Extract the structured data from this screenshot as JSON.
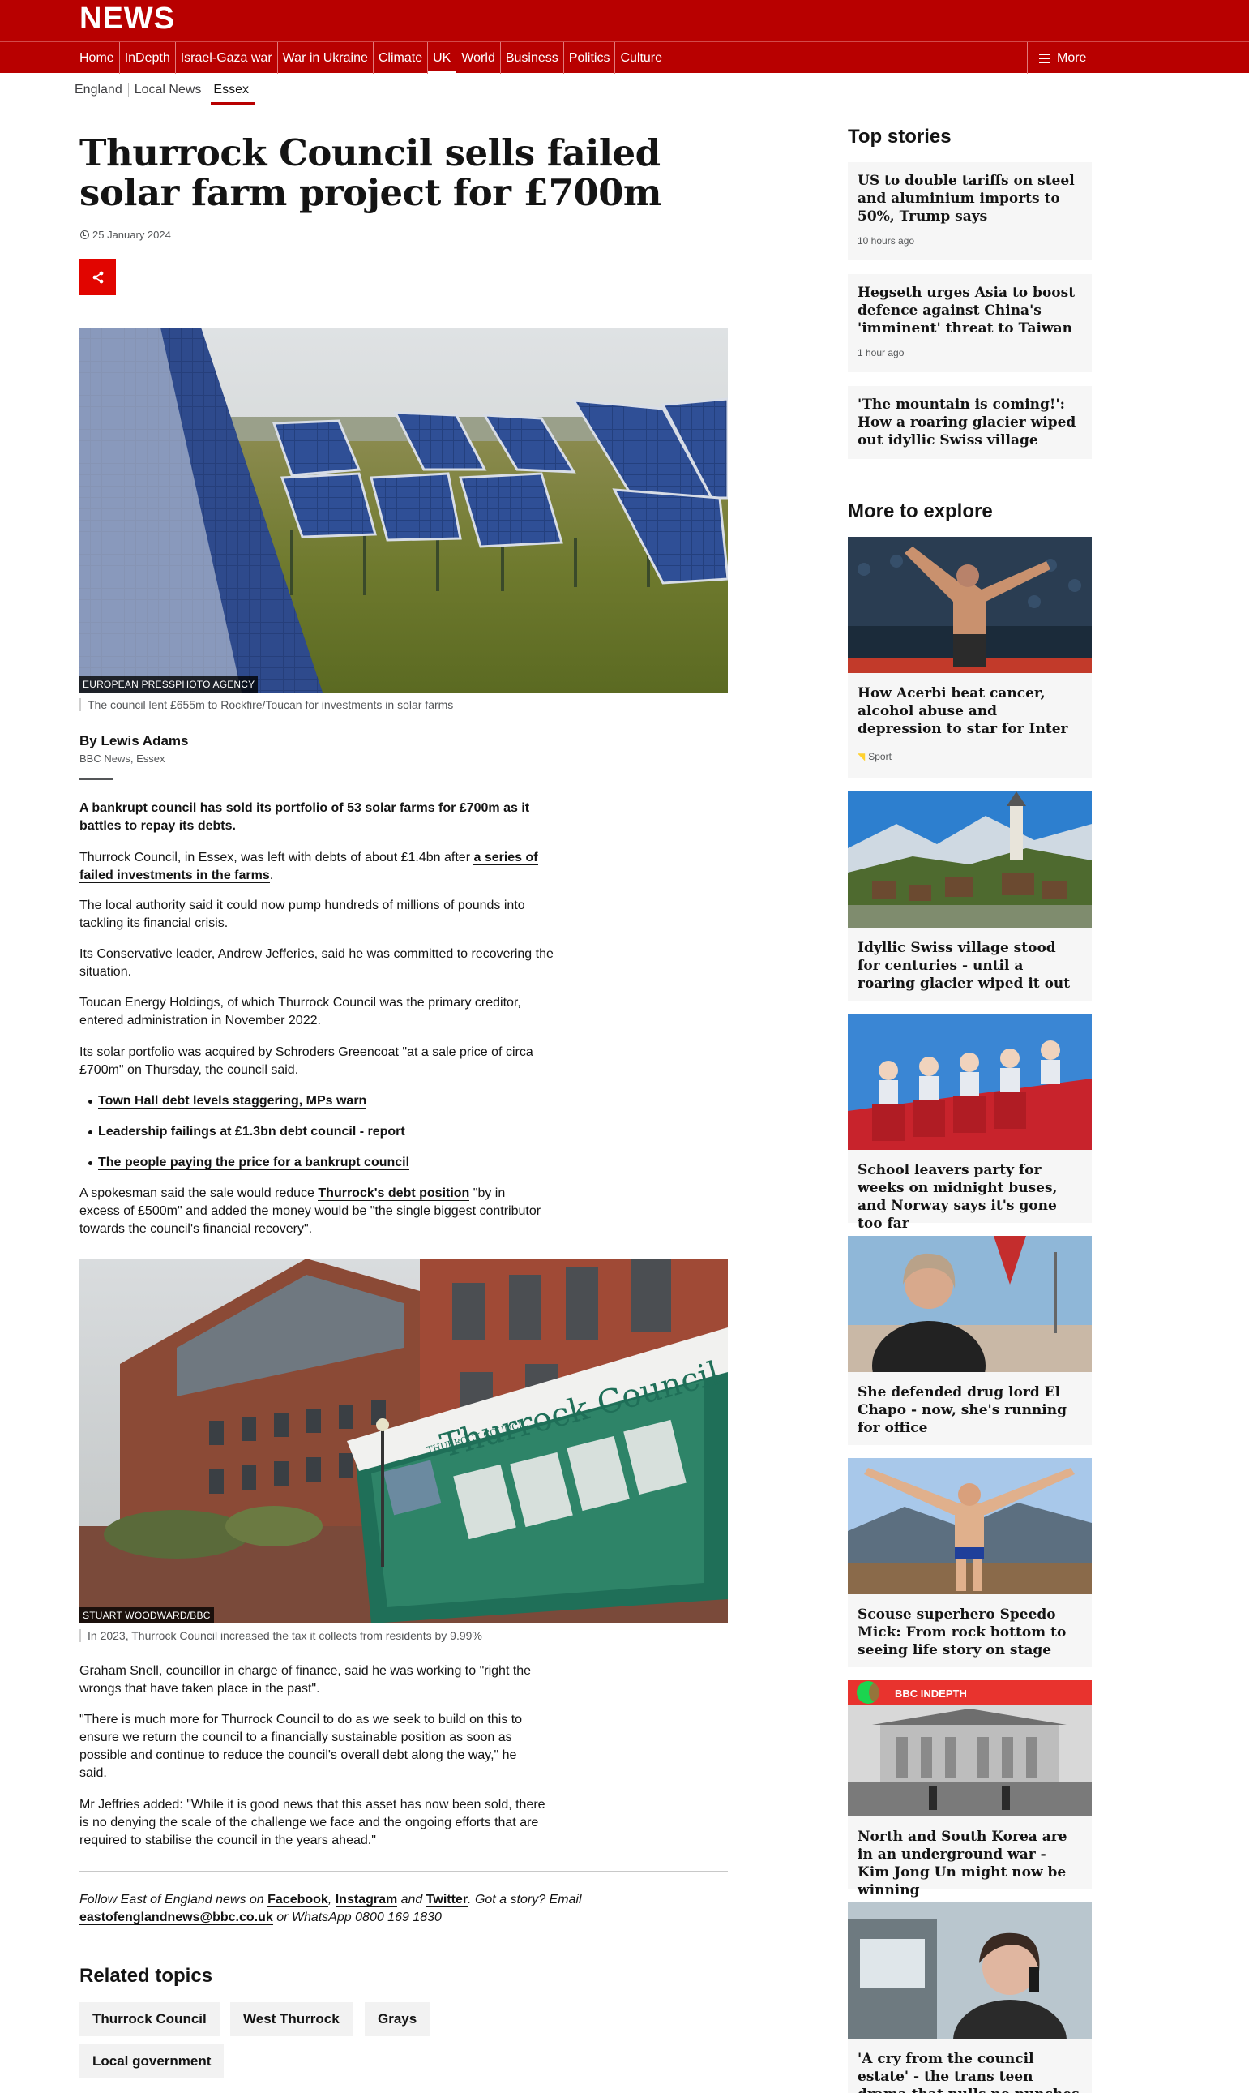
{
  "header": {
    "logo": "NEWS",
    "nav": [
      "Home",
      "InDepth",
      "Israel-Gaza war",
      "War in Ukraine",
      "Climate",
      "UK",
      "World",
      "Business",
      "Politics",
      "Culture"
    ],
    "active_nav": "UK",
    "more_label": "More"
  },
  "subnav": [
    "England",
    "Local News",
    "Essex"
  ],
  "article": {
    "headline": "Thurrock Council sells failed solar farm project for £700m",
    "date": "25 January 2024",
    "image1": {
      "credit": "EUROPEAN PRESSPHOTO AGENCY",
      "caption": "The council lent £655m to Rockfire/Toucan for investments in solar farms"
    },
    "author": "By Lewis Adams",
    "author_role": "BBC News, Essex",
    "lead": "A bankrupt council has sold its portfolio of 53 solar farms for £700m as it battles to repay its debts.",
    "p1_text": "Thurrock Council, in Essex, was left with debts of about £1.4bn after ",
    "p1_link": "a series of failed investments in the farms",
    "p1_end": ".",
    "p2": "The local authority said it could now pump hundreds of millions of pounds into tackling its financial crisis.",
    "p3": "Its Conservative leader, Andrew Jefferies, said he was committed to recovering the situation.",
    "p4": "Toucan Energy Holdings, of which Thurrock Council was the primary creditor, entered administration in November 2022.",
    "p5": "Its solar portfolio was acquired by Schroders Greencoat \"at a sale price of circa £700m\" on Thursday, the council said.",
    "bullets": [
      "Town Hall debt levels staggering, MPs warn",
      "Leadership failings at £1.3bn debt council - report",
      "The people paying the price for a bankrupt council"
    ],
    "p6_a": "A spokesman said the sale would reduce ",
    "p6_link": "Thurrock's debt position",
    "p6_b": " \"by in excess of £500m\" and added the money would be \"the single biggest contributor towards the council's financial recovery\".",
    "image2": {
      "credit": "STUART WOODWARD/BBC",
      "caption": "In 2023, Thurrock Council increased the tax it collects from residents by 9.99%",
      "sign_text": "Thurrock Council",
      "sign_small": "THURROCK COUNCIL"
    },
    "p7": "Graham Snell, councillor in charge of finance, said he was working to \"right the wrongs that have taken place in the past\".",
    "p8": "\"There is much more for Thurrock Council to do as we seek to build on this to ensure we return the council to a financially sustainable position as soon as possible and continue to reduce the council's overall debt along the way,\" he said.",
    "p9": "Mr Jeffries added: \"While it is good news that this asset has now been sold, there is no denying the scale of the challenge we face and the ongoing efforts that are required to stabilise the council in the years ahead.\"",
    "follow": {
      "t1": "Follow East of England news on ",
      "facebook": "Facebook",
      "comma": ", ",
      "instagram": "Instagram",
      "and": " and ",
      "twitter": "Twitter",
      "t2": ". Got a story? Email ",
      "email": "eastofenglandnews@bbc.co.uk",
      "t3": " or WhatsApp 0800 169 1830"
    }
  },
  "related": {
    "title": "Related topics",
    "topics": [
      "Thurrock Council",
      "West Thurrock",
      "Grays",
      "Local government"
    ]
  },
  "sidebar": {
    "top_title": "Top stories",
    "top_stories": [
      {
        "title": "US to double tariffs on steel and aluminium imports to 50%, Trump says",
        "time": "10 hours ago"
      },
      {
        "title": "Hegseth urges Asia to boost defence against China's 'imminent' threat to Taiwan",
        "time": "1 hour ago"
      },
      {
        "title": "'The mountain is coming!': How a roaring glacier wiped out idyllic Swiss village",
        "time": ""
      }
    ],
    "explore_title": "More to explore",
    "explore": [
      {
        "title": "How Acerbi beat cancer, alcohol abuse and depression to star for Inter",
        "tag": "Sport"
      },
      {
        "title": "Idyllic Swiss village stood for centuries - until a roaring glacier wiped it out"
      },
      {
        "title": "School leavers party for weeks on midnight buses, and Norway says it's gone too far"
      },
      {
        "title": "She defended drug lord El Chapo - now, she's running for office"
      },
      {
        "title": "Scouse superhero Speedo Mick: From rock bottom to seeing life story on stage"
      },
      {
        "title": "North and South Korea are in an underground war - Kim Jong Un might now be winning",
        "badge": "BBC INDEPTH"
      },
      {
        "title": "'A cry from the council estate' - the trans teen drama that pulls no punches"
      }
    ]
  }
}
